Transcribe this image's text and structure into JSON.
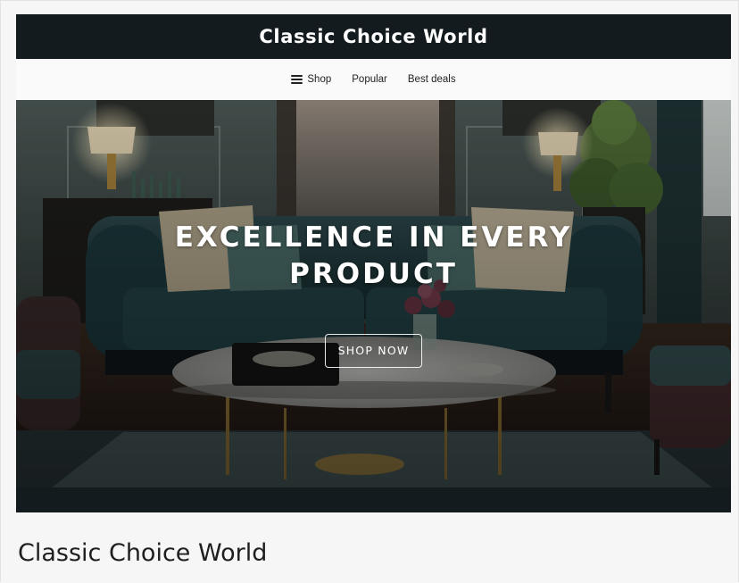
{
  "header": {
    "brand": "Classic Choice World"
  },
  "nav": {
    "items": [
      {
        "label": "Shop",
        "icon": "menu-icon"
      },
      {
        "label": "Popular"
      },
      {
        "label": "Best deals"
      }
    ]
  },
  "hero": {
    "headline": "EXCELLENCE IN EVERY PRODUCT",
    "cta_label": "SHOP NOW",
    "image": "living-room-photo"
  },
  "footer": {
    "title": "Classic Choice World"
  },
  "colors": {
    "topbar_bg": "#141b1f",
    "page_bg": "#f6f6f6",
    "nav_bg": "#fafafa"
  }
}
